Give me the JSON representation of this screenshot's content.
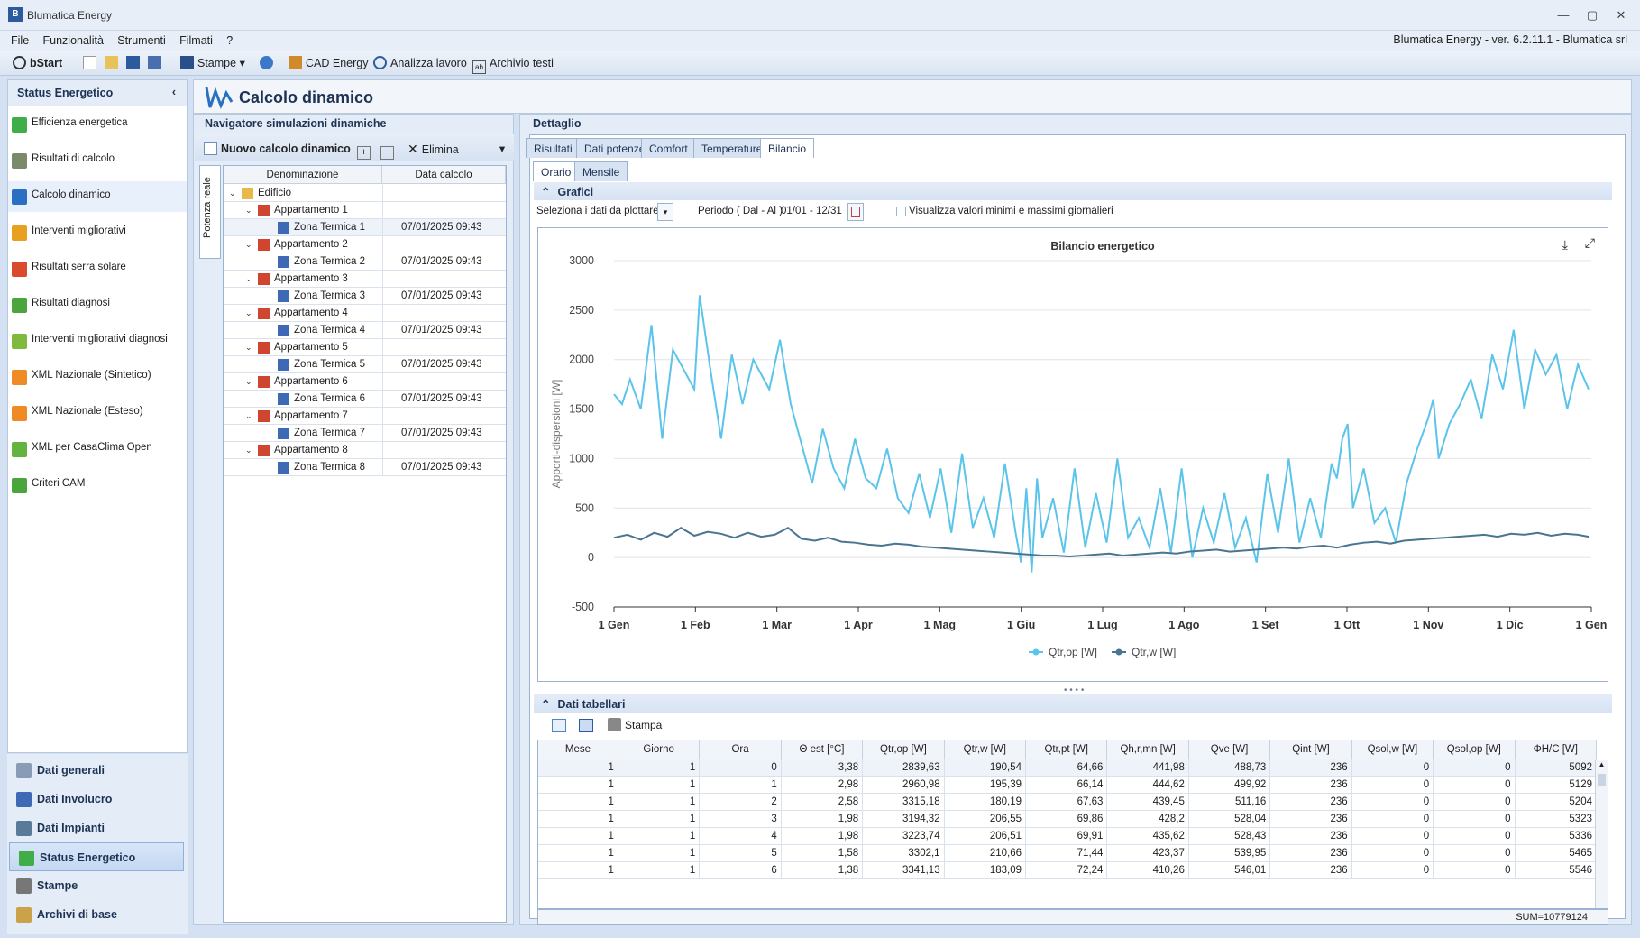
{
  "window": {
    "title": "Blumatica Energy",
    "minimize": "—",
    "restore": "▢",
    "close": "✕"
  },
  "menu": [
    "File",
    "Funzionalità",
    "Strumenti",
    "Filmati",
    "?"
  ],
  "version": "Blumatica Energy - ver. 6.2.11.1 - Blumatica srl",
  "toolbar": {
    "bstart": "bStart",
    "stampe": "Stampe",
    "cad": "CAD Energy",
    "analizza": "Analizza lavoro",
    "archivio": "Archivio testi"
  },
  "sidebar": {
    "title": "Status Energetico",
    "items": [
      {
        "label": "Efficienza energetica",
        "icon": "energy-class-icon",
        "color": "#3fae49"
      },
      {
        "label": "Risultati di calcolo",
        "icon": "calculator-icon",
        "color": "#7a8a6a"
      },
      {
        "label": "Calcolo dinamico",
        "icon": "wave-icon",
        "color": "#2a6fc1"
      },
      {
        "label": "Interventi migliorativi",
        "icon": "energy-class-icon",
        "color": "#e8a020"
      },
      {
        "label": "Risultati serra solare",
        "icon": "energy-class-icon",
        "color": "#d94b2c"
      },
      {
        "label": "Risultati diagnosi",
        "icon": "leaf-icon",
        "color": "#4aa63c"
      },
      {
        "label": "Interventi migliorativi diagnosi",
        "icon": "leaf-gear-icon",
        "color": "#7fba3c"
      },
      {
        "label": "XML Nazionale (Sintetico)",
        "icon": "xml-icon",
        "color": "#f08a24"
      },
      {
        "label": "XML Nazionale (Esteso)",
        "icon": "xml-icon",
        "color": "#f08a24"
      },
      {
        "label": "XML per CasaClima Open",
        "icon": "dots-icon",
        "color": "#63b33f"
      },
      {
        "label": "Criteri CAM",
        "icon": "recycle-icon",
        "color": "#4aa63c"
      }
    ]
  },
  "nav_bottom": [
    {
      "label": "Dati generali",
      "icon": "house-icon",
      "color": "#8a9bb5"
    },
    {
      "label": "Dati Involucro",
      "icon": "building-icon",
      "color": "#3d69b5"
    },
    {
      "label": "Dati Impianti",
      "icon": "plant-icon",
      "color": "#5a7a9a"
    },
    {
      "label": "Status Energetico",
      "icon": "energy-class-icon",
      "color": "#3fae49"
    },
    {
      "label": "Stampe",
      "icon": "printer-icon",
      "color": "#777777"
    },
    {
      "label": "Archivi di base",
      "icon": "archive-icon",
      "color": "#c9a24a"
    }
  ],
  "main_title": "Calcolo dinamico",
  "navigator": {
    "title": "Navigatore simulazioni dinamiche",
    "new_button": "Nuovo calcolo dinamico",
    "delete_button": "Elimina",
    "side_tab": "Potenza reale",
    "columns": [
      "Denominazione",
      "Data calcolo"
    ],
    "rows": [
      {
        "name": "Edificio",
        "date": "",
        "level": 0
      },
      {
        "name": "Appartamento 1",
        "date": "",
        "level": 1
      },
      {
        "name": "Zona Termica 1",
        "date": "07/01/2025 09:43",
        "level": 2
      },
      {
        "name": "Appartamento 2",
        "date": "",
        "level": 1
      },
      {
        "name": "Zona Termica 2",
        "date": "07/01/2025 09:43",
        "level": 2
      },
      {
        "name": "Appartamento 3",
        "date": "",
        "level": 1
      },
      {
        "name": "Zona Termica 3",
        "date": "07/01/2025 09:43",
        "level": 2
      },
      {
        "name": "Appartamento 4",
        "date": "",
        "level": 1
      },
      {
        "name": "Zona Termica 4",
        "date": "07/01/2025 09:43",
        "level": 2
      },
      {
        "name": "Appartamento 5",
        "date": "",
        "level": 1
      },
      {
        "name": "Zona Termica 5",
        "date": "07/01/2025 09:43",
        "level": 2
      },
      {
        "name": "Appartamento 6",
        "date": "",
        "level": 1
      },
      {
        "name": "Zona Termica 6",
        "date": "07/01/2025 09:43",
        "level": 2
      },
      {
        "name": "Appartamento 7",
        "date": "",
        "level": 1
      },
      {
        "name": "Zona Termica 7",
        "date": "07/01/2025 09:43",
        "level": 2
      },
      {
        "name": "Appartamento 8",
        "date": "",
        "level": 1
      },
      {
        "name": "Zona Termica 8",
        "date": "07/01/2025 09:43",
        "level": 2
      }
    ]
  },
  "detail": {
    "title": "Dettaglio",
    "tabs": [
      "Risultati",
      "Dati potenze",
      "Comfort",
      "Temperature",
      "Bilancio"
    ],
    "subtabs": [
      "Orario",
      "Mensile"
    ],
    "grafici": "Grafici",
    "select_label": "Seleziona i dati da plottare",
    "period_label": "Periodo ( Dal - Al )",
    "period_value": "01/01 - 12/31",
    "checkbox_label": "Visualizza valori minimi e massimi giornalieri",
    "tabular_title": "Dati tabellari",
    "print": "Stampa",
    "sum": "SUM=10779124"
  },
  "chart_data": {
    "type": "line",
    "title": "Bilancio energetico",
    "ylabel": "Apporti-dispersioni [W]",
    "xlabel": "",
    "ylim": [
      -500,
      3000
    ],
    "yticks": [
      3000,
      2500,
      2000,
      1500,
      1000,
      500,
      0,
      -500
    ],
    "xticks": [
      "1 Gen",
      "1 Feb",
      "1 Mar",
      "1 Apr",
      "1 Mag",
      "1 Giu",
      "1 Lug",
      "1 Ago",
      "1 Set",
      "1 Ott",
      "1 Nov",
      "1 Dic",
      "1 Gen"
    ],
    "grid": true,
    "legend_position": "bottom-center",
    "series": [
      {
        "name": "Qtr,op [W]",
        "color": "#5bc4ea",
        "x_day": [
          0,
          3,
          6,
          10,
          14,
          18,
          22,
          26,
          30,
          32,
          36,
          40,
          44,
          48,
          52,
          56,
          58,
          62,
          66,
          70,
          74,
          78,
          82,
          86,
          90,
          94,
          98,
          102,
          106,
          110,
          114,
          118,
          122,
          126,
          130,
          134,
          138,
          142,
          146,
          150,
          152,
          154,
          156,
          158,
          160,
          164,
          168,
          172,
          176,
          180,
          184,
          188,
          192,
          196,
          200,
          204,
          208,
          212,
          216,
          220,
          224,
          228,
          232,
          236,
          240,
          244,
          248,
          252,
          256,
          260,
          264,
          268,
          270,
          272,
          274,
          276,
          280,
          284,
          288,
          292,
          296,
          300,
          304,
          306,
          308,
          312,
          316,
          320,
          324,
          328,
          332,
          336,
          340,
          344,
          348,
          352,
          356,
          360,
          364
        ],
        "y": [
          1650,
          1550,
          1800,
          1500,
          2350,
          1200,
          2100,
          1900,
          1700,
          2650,
          1900,
          1200,
          2050,
          1550,
          2000,
          1800,
          1700,
          2200,
          1550,
          1150,
          750,
          1300,
          900,
          700,
          1200,
          800,
          700,
          1100,
          600,
          450,
          850,
          400,
          900,
          250,
          1050,
          300,
          600,
          200,
          950,
          250,
          -50,
          700,
          -150,
          800,
          200,
          600,
          50,
          900,
          100,
          650,
          150,
          1000,
          200,
          400,
          100,
          700,
          50,
          900,
          0,
          500,
          150,
          650,
          100,
          400,
          -50,
          850,
          250,
          1000,
          150,
          600,
          200,
          950,
          800,
          1200,
          1350,
          500,
          900,
          350,
          500,
          150,
          750,
          1100,
          1400,
          1600,
          1000,
          1350,
          1550,
          1800,
          1400,
          2050,
          1700,
          2300,
          1500,
          2100,
          1850,
          2050,
          1500,
          1950,
          1700
        ]
      },
      {
        "name": "Qtr,w [W]",
        "color": "#4a7590",
        "x_day": [
          0,
          5,
          10,
          15,
          20,
          25,
          30,
          35,
          40,
          45,
          50,
          55,
          60,
          65,
          70,
          75,
          80,
          85,
          90,
          95,
          100,
          105,
          110,
          115,
          120,
          125,
          130,
          135,
          140,
          145,
          150,
          155,
          160,
          165,
          170,
          175,
          180,
          185,
          190,
          195,
          200,
          205,
          210,
          215,
          220,
          225,
          230,
          235,
          240,
          245,
          250,
          255,
          260,
          265,
          270,
          275,
          280,
          285,
          290,
          295,
          300,
          305,
          310,
          315,
          320,
          325,
          330,
          335,
          340,
          345,
          350,
          355,
          360,
          364
        ],
        "y": [
          200,
          230,
          180,
          250,
          210,
          300,
          220,
          260,
          240,
          200,
          250,
          210,
          230,
          300,
          190,
          170,
          200,
          160,
          150,
          130,
          120,
          140,
          130,
          110,
          100,
          90,
          80,
          70,
          60,
          50,
          40,
          30,
          20,
          20,
          10,
          20,
          30,
          40,
          20,
          30,
          40,
          50,
          40,
          60,
          70,
          80,
          60,
          70,
          80,
          90,
          100,
          90,
          110,
          120,
          100,
          130,
          150,
          160,
          140,
          170,
          180,
          190,
          200,
          210,
          220,
          230,
          210,
          240,
          230,
          250,
          220,
          240,
          230,
          210
        ]
      }
    ]
  },
  "table": {
    "columns": [
      "Mese",
      "Giorno",
      "Ora",
      "Θ est [°C]",
      "Qtr,op [W]",
      "Qtr,w [W]",
      "Qtr,pt [W]",
      "Qh,r,mn [W]",
      "Qve [W]",
      "Qint [W]",
      "Qsol,w [W]",
      "Qsol,op [W]",
      "ΦH/C [W]"
    ],
    "rows": [
      [
        "1",
        "1",
        "0",
        "3,38",
        "2839,63",
        "190,54",
        "64,66",
        "441,98",
        "488,73",
        "236",
        "0",
        "0",
        "5092"
      ],
      [
        "1",
        "1",
        "1",
        "2,98",
        "2960,98",
        "195,39",
        "66,14",
        "444,62",
        "499,92",
        "236",
        "0",
        "0",
        "5129"
      ],
      [
        "1",
        "1",
        "2",
        "2,58",
        "3315,18",
        "180,19",
        "67,63",
        "439,45",
        "511,16",
        "236",
        "0",
        "0",
        "5204"
      ],
      [
        "1",
        "1",
        "3",
        "1,98",
        "3194,32",
        "206,55",
        "69,86",
        "428,2",
        "528,04",
        "236",
        "0",
        "0",
        "5323"
      ],
      [
        "1",
        "1",
        "4",
        "1,98",
        "3223,74",
        "206,51",
        "69,91",
        "435,62",
        "528,43",
        "236",
        "0",
        "0",
        "5336"
      ],
      [
        "1",
        "1",
        "5",
        "1,58",
        "3302,1",
        "210,66",
        "71,44",
        "423,37",
        "539,95",
        "236",
        "0",
        "0",
        "5465"
      ],
      [
        "1",
        "1",
        "6",
        "1,38",
        "3341,13",
        "183,09",
        "72,24",
        "410,26",
        "546,01",
        "236",
        "0",
        "0",
        "5546"
      ]
    ]
  }
}
